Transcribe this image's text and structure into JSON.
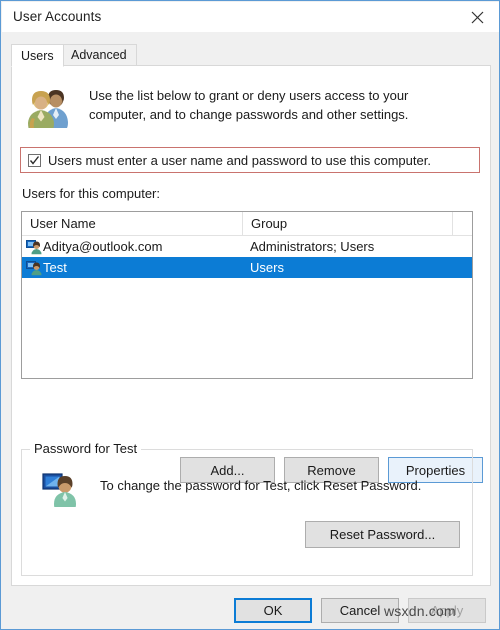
{
  "window": {
    "title": "User Accounts",
    "close_icon": "close-icon",
    "accent_color": "#0c7cd5",
    "highlight_border_color": "#c9736e",
    "selection_color": "#0c7cd5"
  },
  "tabs": [
    {
      "label": "Users",
      "selected": true
    },
    {
      "label": "Advanced",
      "selected": false
    }
  ],
  "intro": {
    "icon": "two-users-icon",
    "text": "Use the list below to grant or deny users access to your computer, and to change passwords and other settings."
  },
  "require_password_checkbox": {
    "label": "Users must enter a user name and password to use this computer.",
    "checked": true,
    "highlighted": true
  },
  "users_list": {
    "label": "Users for this computer:",
    "columns": [
      "User Name",
      "Group"
    ],
    "rows": [
      {
        "icon": "user-icon",
        "name": "Aditya@outlook.com",
        "group": "Administrators; Users",
        "selected": false
      },
      {
        "icon": "user-icon",
        "name": "Test",
        "group": "Users",
        "selected": true
      }
    ]
  },
  "list_buttons": {
    "add": "Add...",
    "remove": "Remove",
    "properties": "Properties"
  },
  "password_group": {
    "title": "Password for Test",
    "icon": "user-monitor-icon",
    "description": "To change the password for Test, click Reset Password.",
    "reset_button": "Reset Password..."
  },
  "footer": {
    "ok": "OK",
    "cancel": "Cancel",
    "apply": "Apply",
    "apply_disabled": true
  },
  "watermark": "wsxdn.com"
}
